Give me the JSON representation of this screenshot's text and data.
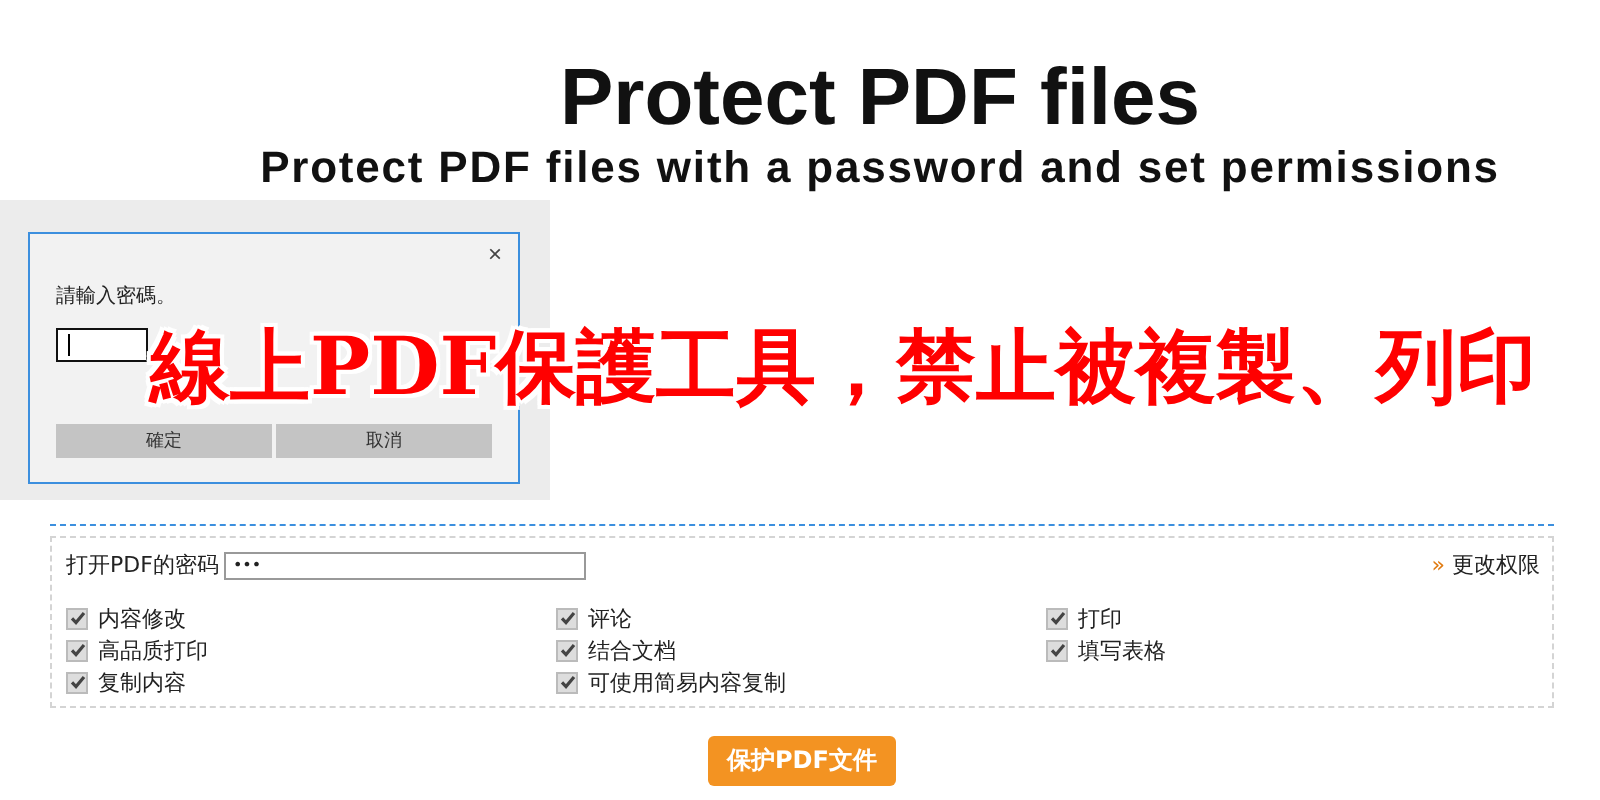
{
  "header": {
    "title": "Protect PDF files",
    "subtitle": "Protect PDF files with a password and set permissions"
  },
  "dialog": {
    "close": "×",
    "prompt": "請輸入密碼。",
    "buttons": [
      "確定",
      "取消"
    ]
  },
  "banner": {
    "caption": "線上PDF保護工具，禁止被複製、列印"
  },
  "form": {
    "password_label": "打开PDF的密码",
    "password_value": "•••",
    "change_link": "更改权限",
    "link_mark": "»",
    "permissions": [
      {
        "label": "内容修改",
        "checked": true
      },
      {
        "label": "评论",
        "checked": true
      },
      {
        "label": "打印",
        "checked": true
      },
      {
        "label": "高品质打印",
        "checked": true
      },
      {
        "label": "结合文档",
        "checked": true
      },
      {
        "label": "填写表格",
        "checked": true
      },
      {
        "label": "复制内容",
        "checked": true
      },
      {
        "label": "可使用简易内容复制",
        "checked": true
      }
    ],
    "submit": "保护PDF文件"
  }
}
